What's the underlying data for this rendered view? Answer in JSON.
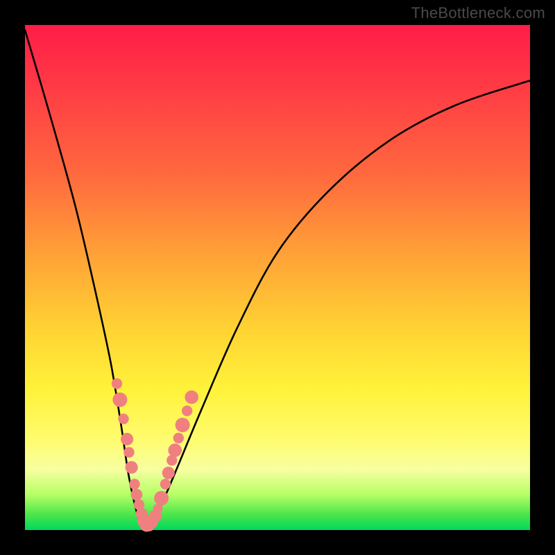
{
  "watermark": "TheBottleneck.com",
  "chart_data": {
    "type": "line",
    "title": "",
    "xlabel": "",
    "ylabel": "",
    "xlim": [
      0,
      100
    ],
    "ylim": [
      0,
      100
    ],
    "grid": false,
    "legend": false,
    "series": [
      {
        "name": "bottleneck-curve",
        "x": [
          0,
          5,
          10,
          14,
          17,
          19,
          20.5,
          22,
          23,
          24,
          25,
          27,
          30,
          35,
          42,
          50,
          60,
          72,
          85,
          100
        ],
        "y": [
          99,
          82,
          64,
          47,
          33,
          21,
          11,
          4,
          1,
          0,
          1,
          5,
          12,
          24,
          40,
          55,
          67,
          77,
          84,
          89
        ]
      }
    ],
    "markers": {
      "name": "highlight-dots",
      "color": "#f08080",
      "points": [
        {
          "x": 18.2,
          "y": 29.0,
          "r": 1.1
        },
        {
          "x": 18.8,
          "y": 25.8,
          "r": 1.5
        },
        {
          "x": 19.5,
          "y": 22.0,
          "r": 1.1
        },
        {
          "x": 20.2,
          "y": 18.0,
          "r": 1.3
        },
        {
          "x": 20.6,
          "y": 15.4,
          "r": 1.1
        },
        {
          "x": 21.1,
          "y": 12.4,
          "r": 1.3
        },
        {
          "x": 21.7,
          "y": 9.1,
          "r": 1.1
        },
        {
          "x": 22.1,
          "y": 7.0,
          "r": 1.2
        },
        {
          "x": 22.6,
          "y": 5.0,
          "r": 1.1
        },
        {
          "x": 23.1,
          "y": 3.2,
          "r": 1.2
        },
        {
          "x": 23.6,
          "y": 1.8,
          "r": 1.4
        },
        {
          "x": 24.1,
          "y": 1.0,
          "r": 1.4
        },
        {
          "x": 24.6,
          "y": 0.9,
          "r": 1.2
        },
        {
          "x": 25.2,
          "y": 1.4,
          "r": 1.1
        },
        {
          "x": 25.8,
          "y": 2.7,
          "r": 1.3
        },
        {
          "x": 26.3,
          "y": 4.2,
          "r": 1.0
        },
        {
          "x": 27.0,
          "y": 6.3,
          "r": 1.5
        },
        {
          "x": 27.8,
          "y": 9.1,
          "r": 1.1
        },
        {
          "x": 28.4,
          "y": 11.3,
          "r": 1.3
        },
        {
          "x": 29.1,
          "y": 13.8,
          "r": 1.1
        },
        {
          "x": 29.7,
          "y": 15.8,
          "r": 1.4
        },
        {
          "x": 30.4,
          "y": 18.2,
          "r": 1.1
        },
        {
          "x": 31.2,
          "y": 20.8,
          "r": 1.5
        },
        {
          "x": 32.1,
          "y": 23.6,
          "r": 1.1
        },
        {
          "x": 33.0,
          "y": 26.3,
          "r": 1.4
        }
      ]
    }
  }
}
